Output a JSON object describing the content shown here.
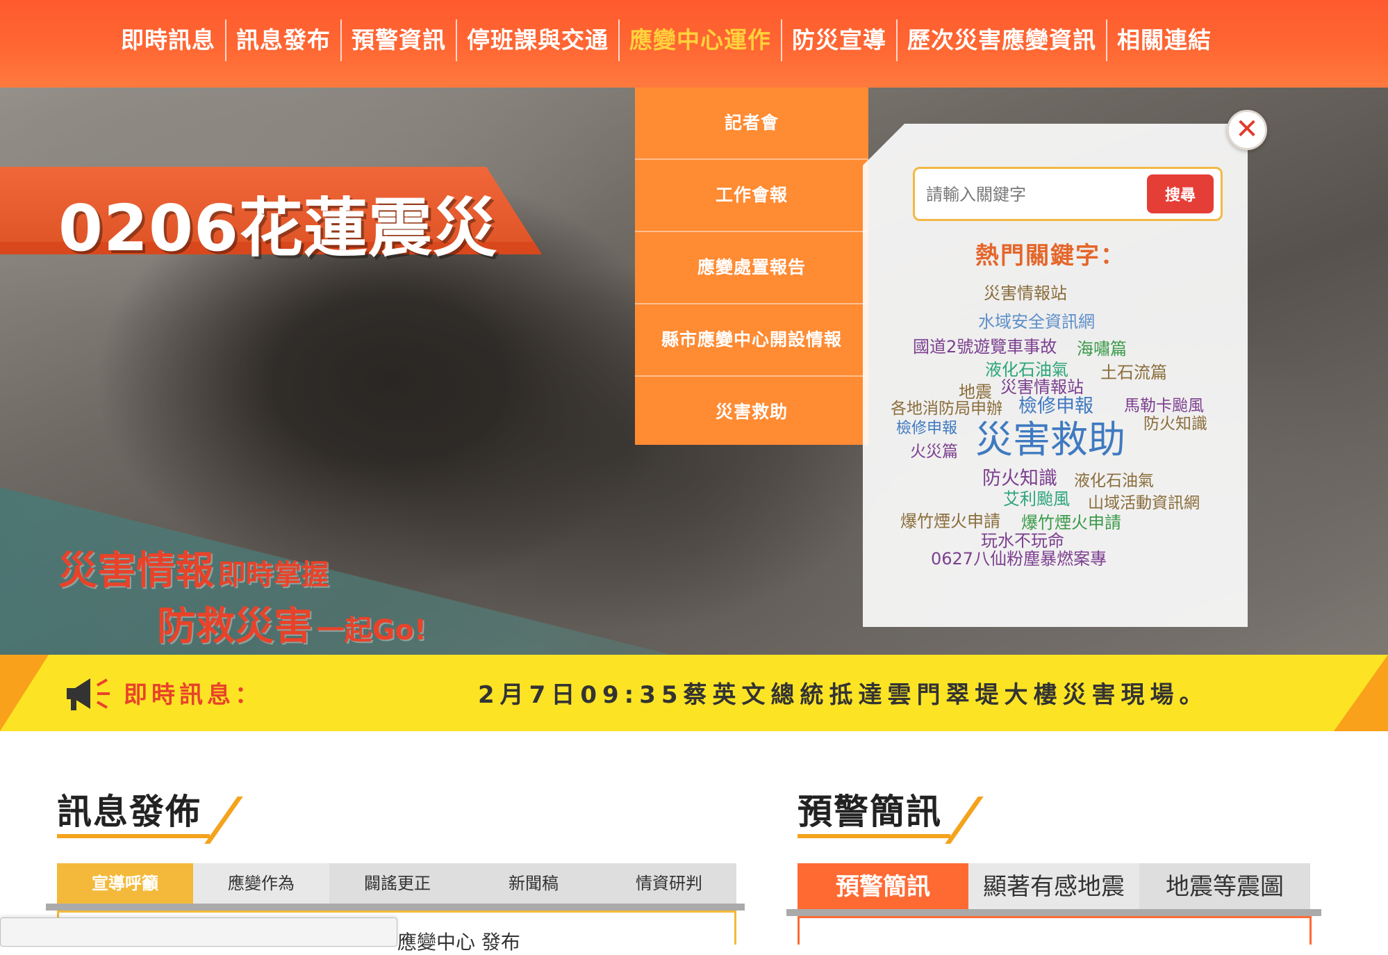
{
  "nav": {
    "items": [
      {
        "label": "即時訊息"
      },
      {
        "label": "訊息發布"
      },
      {
        "label": "預警資訊"
      },
      {
        "label": "停班課與交通"
      },
      {
        "label": "應變中心運作"
      },
      {
        "label": "防災宣導"
      },
      {
        "label": "歷次災害應變資訊"
      },
      {
        "label": "相關連結"
      }
    ],
    "active_index": 4
  },
  "dropdown": {
    "items": [
      {
        "label": "記者會"
      },
      {
        "label": "工作會報"
      },
      {
        "label": "應變處置報告"
      },
      {
        "label": "縣市應變中心開設情報"
      },
      {
        "label": "災害救助"
      }
    ]
  },
  "hero": {
    "title": "0206花蓮震災",
    "slogan1_big": "災害情報",
    "slogan1_small": "即時掌握",
    "slogan2_big": "防救災害",
    "slogan2_small": "一起Go!"
  },
  "search": {
    "placeholder": "請輸入關鍵字",
    "button_label": "搜尋",
    "close_icon": "close-icon"
  },
  "hot_keywords": {
    "title": "熱門關鍵字：",
    "items": [
      {
        "text": "災害情報站",
        "color": "#8a6d3b"
      },
      {
        "text": "水域安全資訊網",
        "color": "#5d8fc9"
      },
      {
        "text": "國道2號遊覽車事故",
        "color": "#7b3f8f"
      },
      {
        "text": "海嘯篇",
        "color": "#3a9a4a"
      },
      {
        "text": "液化石油氣",
        "color": "#2aa57a"
      },
      {
        "text": "土石流篇",
        "color": "#8a6d3b"
      },
      {
        "text": "地震",
        "color": "#8a6d3b"
      },
      {
        "text": "災害情報站",
        "color": "#7b3f8f"
      },
      {
        "text": "各地消防局申辦",
        "color": "#8a6d3b"
      },
      {
        "text": "檢修申報",
        "color": "#3f7ac0"
      },
      {
        "text": "馬勒卡颱風",
        "color": "#7b3f8f"
      },
      {
        "text": "檢修申報",
        "color": "#3f7ac0"
      },
      {
        "text": "災害救助",
        "color": "#3f7ac0"
      },
      {
        "text": "防火知識",
        "color": "#8a6d3b"
      },
      {
        "text": "火災篇",
        "color": "#7b3f8f"
      },
      {
        "text": "防火知識",
        "color": "#7b3f8f"
      },
      {
        "text": "液化石油氣",
        "color": "#8a6d3b"
      },
      {
        "text": "艾利颱風",
        "color": "#2aa57a"
      },
      {
        "text": "山域活動資訊網",
        "color": "#8a6d3b"
      },
      {
        "text": "爆竹煙火申請",
        "color": "#8a6d3b"
      },
      {
        "text": "爆竹煙火申請",
        "color": "#3a9a4a"
      },
      {
        "text": "玩水不玩命",
        "color": "#7b3f8f"
      },
      {
        "text": "0627八仙粉塵暴燃案專",
        "color": "#7b3f8f"
      }
    ]
  },
  "ticker": {
    "label": "即時訊息：",
    "message": "2月7日09:35蔡英文總統抵達雲門翠堤大樓災害現場。",
    "icon": "megaphone-icon"
  },
  "news_section": {
    "title": "訊息發佈",
    "tabs": [
      {
        "label": "宣導呼籲"
      },
      {
        "label": "應變作為"
      },
      {
        "label": "闢謠更正"
      },
      {
        "label": "新聞稿"
      },
      {
        "label": "情資研判"
      }
    ],
    "active_tab": 0,
    "partial_text": "應變中心 發布"
  },
  "warning_section": {
    "title": "預警簡訊",
    "tabs": [
      {
        "label": "預警簡訊"
      },
      {
        "label": "顯著有感地震"
      },
      {
        "label": "地震等震圖"
      }
    ],
    "active_tab": 0
  },
  "colors": {
    "nav_bg": "#ff6733",
    "nav_active": "#ffd23c",
    "dropdown_bg": "#ff8b33",
    "ticker_bg": "#fce425",
    "accent_red": "#e8432a",
    "accent_yellow": "#f4b93a"
  }
}
